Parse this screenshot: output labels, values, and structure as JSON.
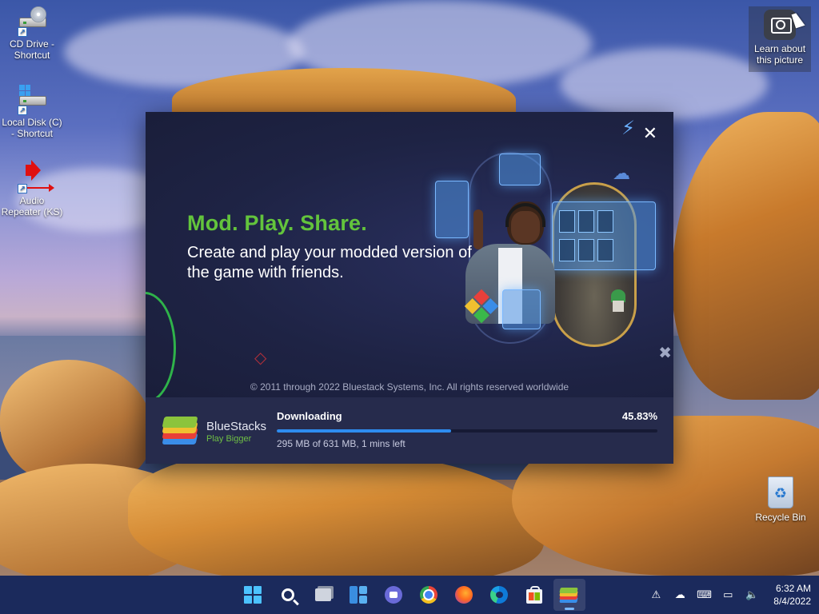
{
  "desktop": {
    "icons": [
      {
        "label": "CD Drive - Shortcut"
      },
      {
        "label": "Local Disk (C) - Shortcut"
      },
      {
        "label": "Audio Repeater (KS)"
      }
    ],
    "learn_label": "Learn about this picture",
    "recycle_label": "Recycle Bin"
  },
  "installer": {
    "headline": "Mod. Play. Share.",
    "subline": "Create and play your modded version of the game with friends.",
    "copyright": "© 2011 through 2022 Bluestack Systems, Inc. All rights reserved worldwide",
    "close_glyph": "✕",
    "bolt_glyph": "⚡",
    "brand": "BlueStacks",
    "tagline": "Play Bigger",
    "status": "Downloading",
    "percent_label": "45.83%",
    "progress_fraction": 0.4583,
    "detail": "295 MB of 631 MB, 1 mins left",
    "colors": {
      "headline": "#63c43c",
      "progress": "#2e8cf0",
      "background": "#1d2240"
    }
  },
  "taskbar": {
    "apps": [
      {
        "name": "start-icon"
      },
      {
        "name": "search-icon"
      },
      {
        "name": "task-view-icon"
      },
      {
        "name": "widgets-icon"
      },
      {
        "name": "teams-chat-icon"
      },
      {
        "name": "chrome-icon"
      },
      {
        "name": "firefox-icon"
      },
      {
        "name": "edge-icon"
      },
      {
        "name": "store-icon"
      },
      {
        "name": "bluestacks-icon",
        "active": true
      }
    ],
    "tray": {
      "time": "6:32 AM",
      "date": "8/4/2022"
    }
  }
}
